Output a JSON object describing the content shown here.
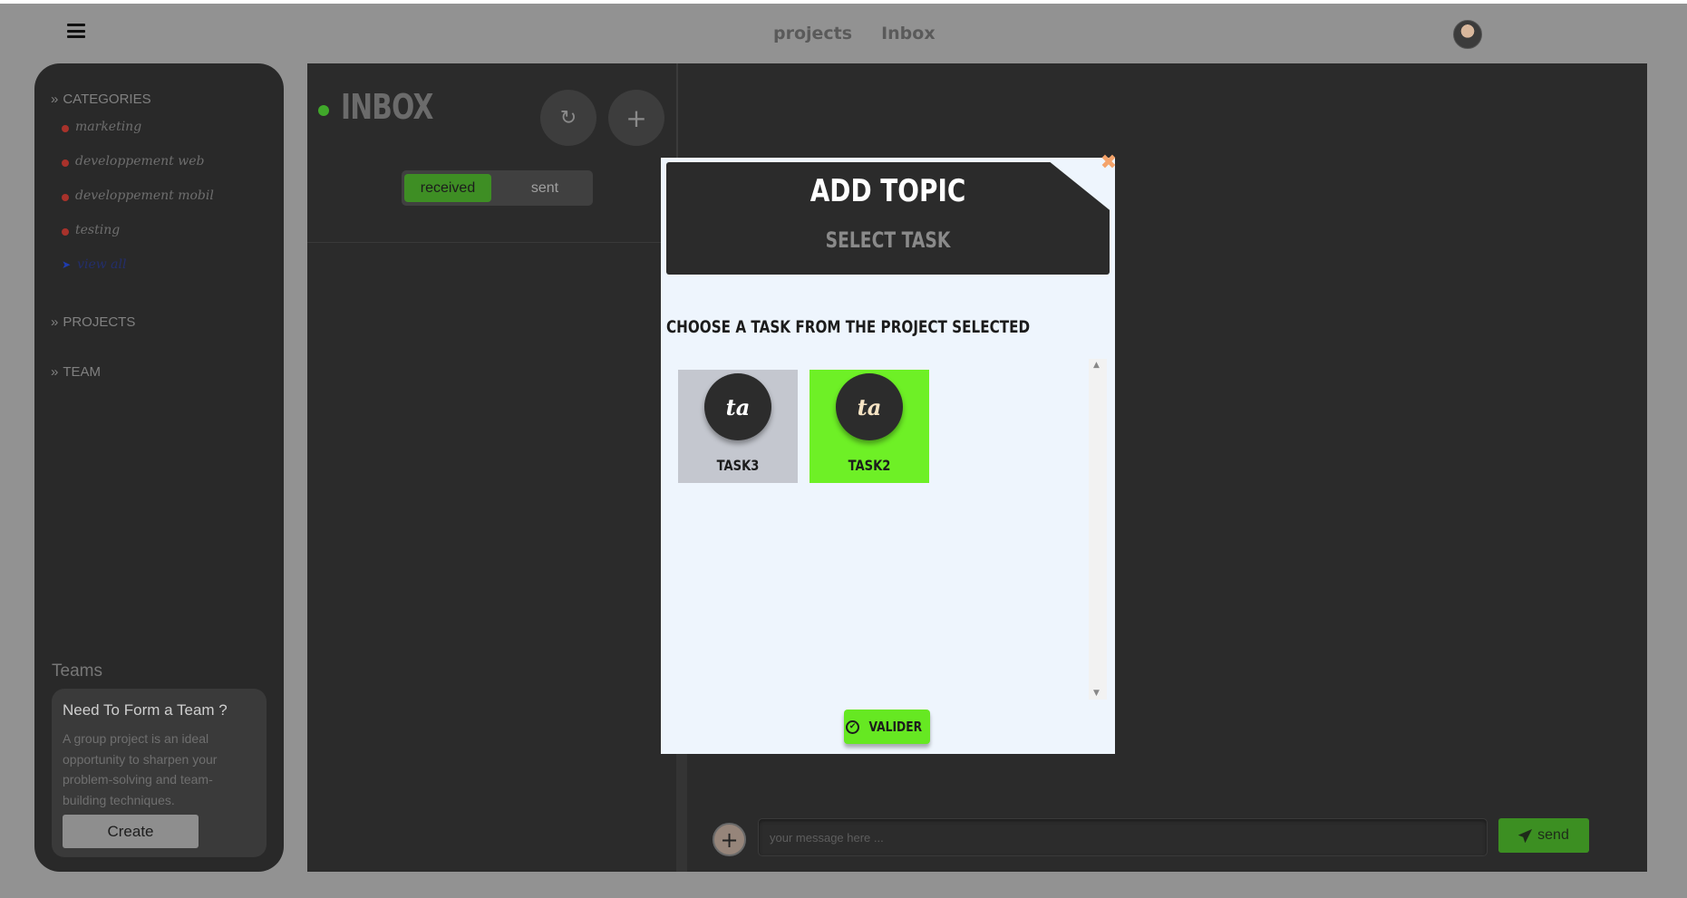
{
  "nav": {
    "links": [
      "projects",
      "Inbox"
    ]
  },
  "sidebar": {
    "categories_heading": "CATEGORIES",
    "categories": [
      {
        "label": "marketing"
      },
      {
        "label": "developpement web"
      },
      {
        "label": "developpement mobil"
      },
      {
        "label": "testing"
      }
    ],
    "more_label": "view all",
    "projects_heading": "PROJECTS",
    "team_heading": "TEAM",
    "teams_title": "Teams",
    "team_card": {
      "title": "Need To Form a Team ?",
      "text": "A group project is an ideal opportunity to sharpen your problem-solving and team-building techniques.",
      "button": "Create"
    }
  },
  "inbox": {
    "title": "INBOX",
    "refresh_icon": "↻",
    "add_icon": "+",
    "tabs": [
      {
        "label": "received",
        "active": true
      },
      {
        "label": "sent",
        "active": false
      }
    ]
  },
  "composer": {
    "attach_icon": "+",
    "placeholder": "your message here ...",
    "send_label": "send"
  },
  "modal": {
    "title": "ADD TOPIC",
    "subtitle": "SELECT TASK",
    "close_icon": "✖",
    "prompt": "CHOOSE A TASK FROM THE PROJECT SELECTED",
    "tasks": [
      {
        "initials": "ta",
        "name": "TASK3",
        "selected": false
      },
      {
        "initials": "ta",
        "name": "TASK2",
        "selected": true
      }
    ],
    "validate_label": "VALIDER"
  },
  "colors": {
    "accent_green": "#40a82a",
    "selected_task": "#6ef026",
    "category_dot": "#a8322b"
  }
}
